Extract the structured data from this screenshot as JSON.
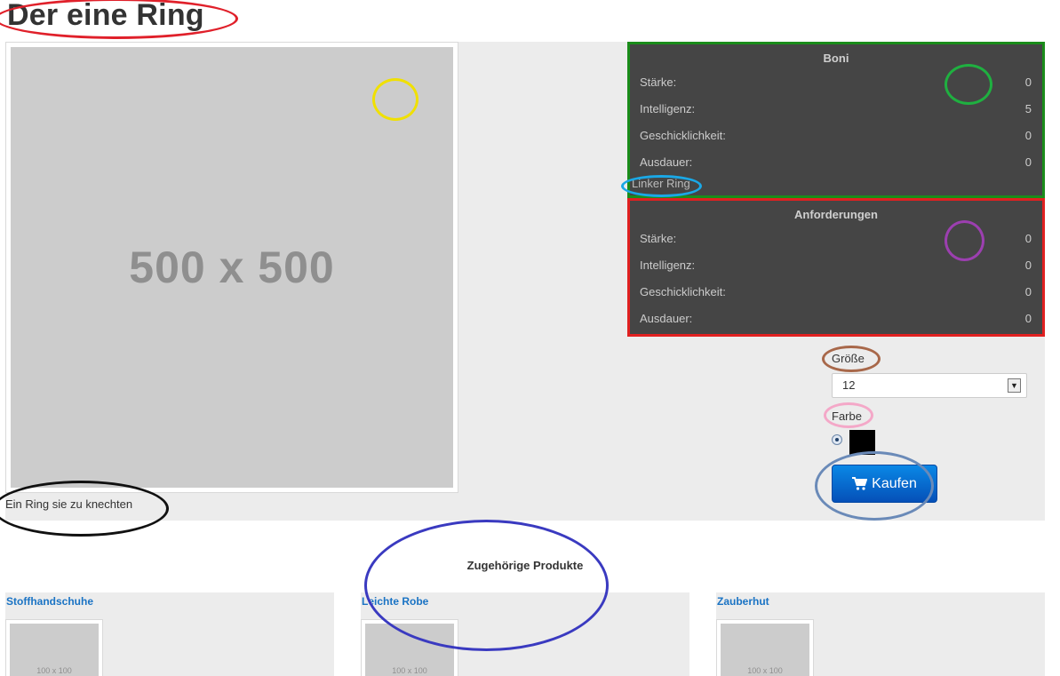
{
  "product": {
    "title": "Der eine Ring",
    "image_placeholder": "500 x 500",
    "description": "Ein Ring sie zu knechten"
  },
  "boni": {
    "heading": "Boni",
    "rows": [
      {
        "label": "Stärke:",
        "value": "0"
      },
      {
        "label": "Intelligenz:",
        "value": "5"
      },
      {
        "label": "Geschicklichkeit:",
        "value": "0"
      },
      {
        "label": "Ausdauer:",
        "value": "0"
      }
    ],
    "slot": "Linker Ring"
  },
  "requirements": {
    "heading": "Anforderungen",
    "rows": [
      {
        "label": "Stärke:",
        "value": "0"
      },
      {
        "label": "Intelligenz:",
        "value": "0"
      },
      {
        "label": "Geschicklichkeit:",
        "value": "0"
      },
      {
        "label": "Ausdauer:",
        "value": "0"
      }
    ]
  },
  "options": {
    "size_label": "Größe",
    "size_value": "12",
    "color_label": "Farbe",
    "color_value": "#000000",
    "buy_label": "Kaufen"
  },
  "related": {
    "heading": "Zugehörige Produkte",
    "items": [
      {
        "name": "Stoffhandschuhe",
        "thumb": "100 x 100"
      },
      {
        "name": "Leichte Robe",
        "thumb": "100 x 100"
      },
      {
        "name": "Zauberhut",
        "thumb": "100 x 100"
      }
    ]
  },
  "colors": {
    "panel": "#454545",
    "boni_border": "#1a8c1a",
    "requirements_border": "#e02020",
    "button": "#0a6fd4",
    "link": "#1a73c4"
  },
  "icons": {
    "buy_button": "cart-icon",
    "select_arrow": "chevron-down-icon"
  }
}
